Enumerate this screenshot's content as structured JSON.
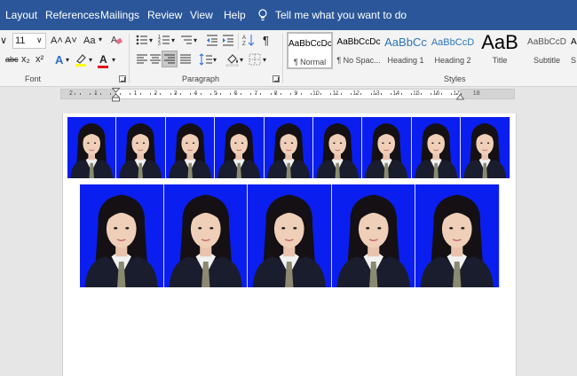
{
  "tabs": [
    "Layout",
    "References",
    "Mailings",
    "Review",
    "View",
    "Help"
  ],
  "tell_me": "Tell me what you want to do",
  "ribbon": {
    "font_size": "11",
    "groups": {
      "font": "Font",
      "paragraph": "Paragraph",
      "styles": "Styles"
    },
    "buttons": {
      "grow_font": "A˄",
      "shrink_font": "A˅",
      "change_case": "Aa",
      "strikethrough": "abc",
      "subscript": "x₂",
      "superscript": "x²",
      "font_color": "A"
    },
    "styles": [
      {
        "sample": "AaBbCcDc",
        "name": "¶ Normal"
      },
      {
        "sample": "AaBbCcDc",
        "name": "¶ No Spac..."
      },
      {
        "sample": "AaBbCc",
        "name": "Heading 1"
      },
      {
        "sample": "AaBbCcD",
        "name": "Heading 2"
      },
      {
        "sample": "AaB",
        "name": "Title"
      },
      {
        "sample": "AaBbCcD",
        "name": "Subtitle"
      },
      {
        "sample": "A",
        "name": "S"
      }
    ]
  },
  "ruler": {
    "left_labels": [
      "2",
      "1"
    ],
    "right_labels": [
      "1",
      "2",
      "3",
      "4",
      "5",
      "6",
      "7",
      "8",
      "9",
      "10",
      "11",
      "12",
      "13",
      "14",
      "15",
      "16",
      "17",
      "18"
    ]
  },
  "document": {
    "row1_photos": 9,
    "row2_photos": 5
  },
  "colors": {
    "title_bar": "#2b579a",
    "ribbon": "#f3f3f3",
    "photo_background": "#0b1ef0",
    "font_color_underline": "#e01515",
    "highlight": "#ffff00"
  }
}
